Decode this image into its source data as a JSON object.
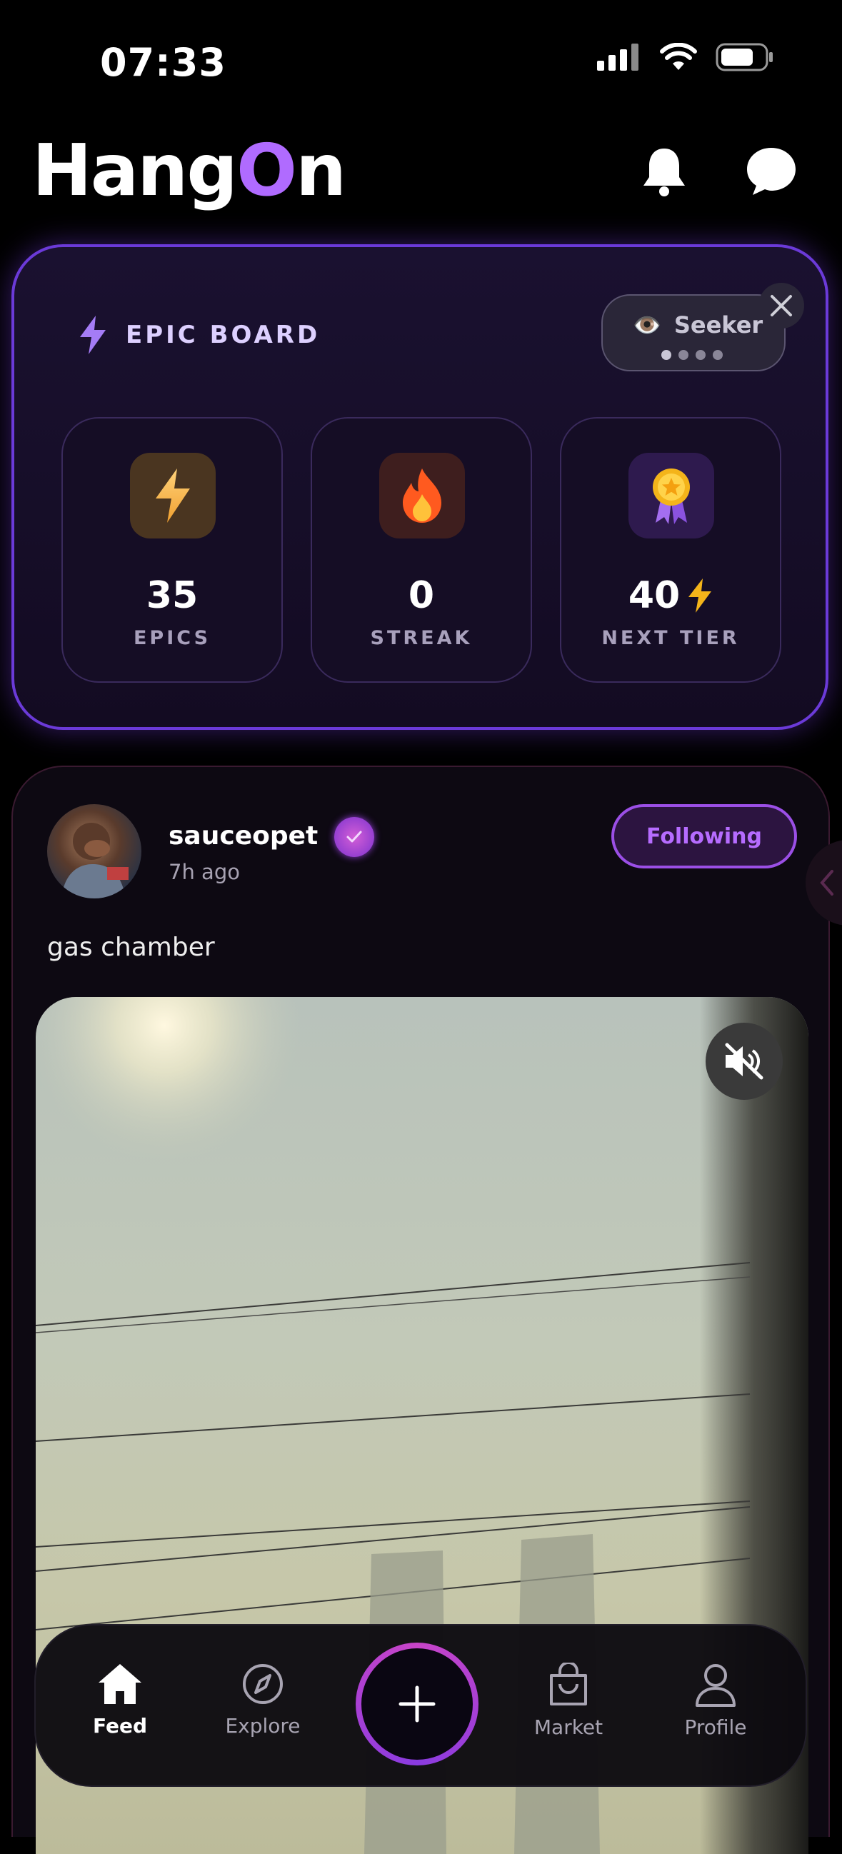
{
  "status_bar": {
    "time": "07:33"
  },
  "header": {
    "logo_prefix": "Hang",
    "logo_accent": "O",
    "logo_suffix": "n",
    "accent_color": "#b06bff"
  },
  "epic_board": {
    "title": "EPIC BOARD",
    "tier": {
      "emoji": "👁️",
      "label": "Seeker",
      "progress_dots": 4,
      "active_dot": 1
    },
    "stats": [
      {
        "value": "35",
        "caption": "EPICS",
        "icon": "lightning-icon"
      },
      {
        "value": "0",
        "caption": "STREAK",
        "icon": "flame-icon"
      },
      {
        "value": "40",
        "caption": "NEXT TIER",
        "icon": "medal-icon"
      }
    ]
  },
  "post": {
    "username": "sauceopet",
    "time_ago": "7h ago",
    "follow_label": "Following",
    "caption": "gas chamber"
  },
  "nav": {
    "items": [
      {
        "label": "Feed",
        "icon": "home-icon",
        "active": true
      },
      {
        "label": "Explore",
        "icon": "compass-icon",
        "active": false
      },
      {
        "label": "Market",
        "icon": "shopping-bag-icon",
        "active": false
      },
      {
        "label": "Profile",
        "icon": "person-icon",
        "active": false
      }
    ],
    "create_icon": "plus-icon"
  }
}
